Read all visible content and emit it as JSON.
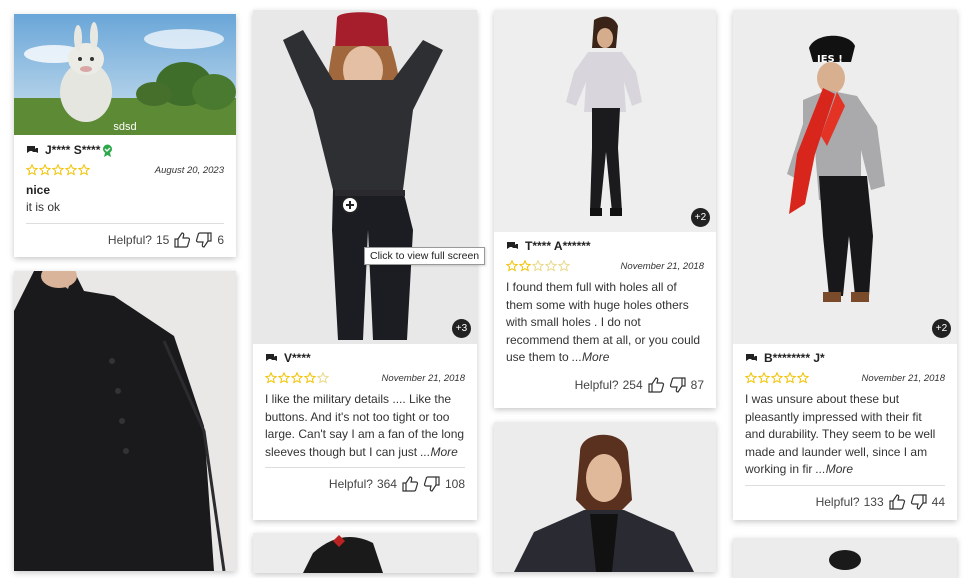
{
  "cards": [
    {
      "name": "J**** S****",
      "date": "August 20, 2023",
      "rating": 5,
      "title": "nice",
      "body": "it is ok",
      "more": "",
      "helpful_label": "Helpful?",
      "up": "15",
      "down": "6",
      "caption": "sdsd"
    },
    {
      "name": "V****",
      "date": "November 21, 2018",
      "rating": 4,
      "title": "",
      "body": "I like the military details .... Like the buttons. And it's not too tight or too large. Can't say I am a fan of the long sleeves though but I can just",
      "more": "...More",
      "helpful_label": "Helpful?",
      "up": "364",
      "down": "108",
      "extra_photos": "+3"
    },
    {
      "name": "T**** A******",
      "date": "November 21, 2018",
      "rating": 2,
      "title": "",
      "body": "I found them full with holes all of them some with huge holes others with small holes . I do not recommend them at all, or you could use them to",
      "more": "...More",
      "helpful_label": "Helpful?",
      "up": "254",
      "down": "87",
      "extra_photos": "+2"
    },
    {
      "name": "B******** J*",
      "date": "November 21, 2018",
      "rating": 5,
      "title": "",
      "body": "I was unsure about these but pleasantly impressed with their fit and durability. They seem to be well made and launder well, since I am working in fir",
      "more": "...More",
      "helpful_label": "Helpful?",
      "up": "133",
      "down": "44",
      "extra_photos": "+2"
    }
  ],
  "tooltip": "Click to view full screen",
  "colors": {
    "star": "#f2c200",
    "badge": "#2ca94a",
    "dark": "#222222"
  },
  "icons": {
    "chat": "chat-bubbles-icon",
    "verified": "verified-badge-icon",
    "up": "thumbs-up-icon",
    "down": "thumbs-down-icon",
    "zoom": "zoom-in-icon"
  }
}
